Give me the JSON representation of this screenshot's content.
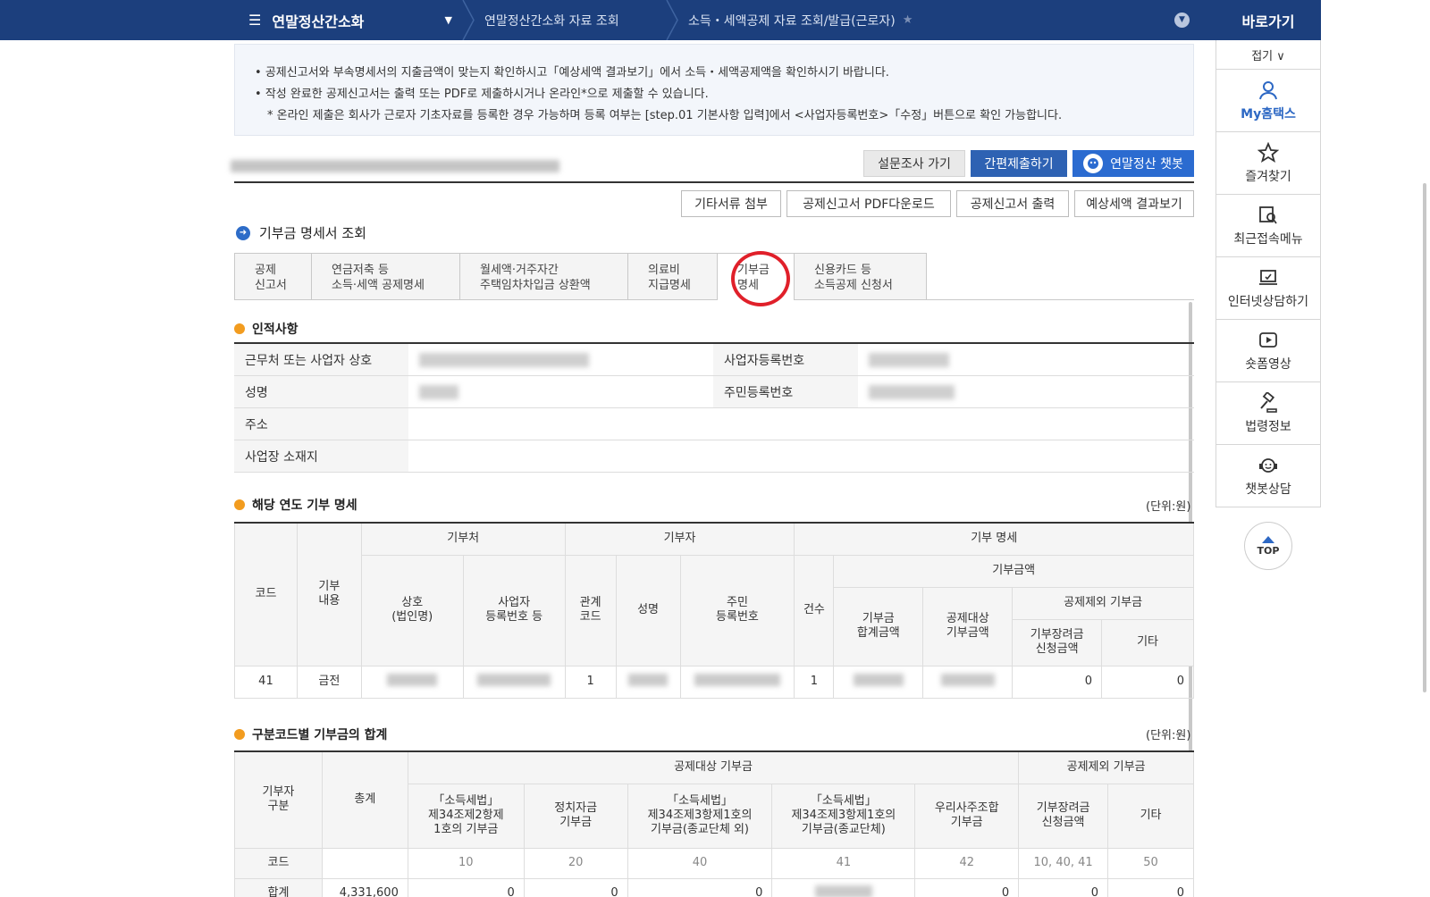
{
  "topbar": {
    "menu_label": "연말정산간소화",
    "crumb1": "연말정산간소화 자료 조회",
    "crumb2": "소득・세액공제 자료 조회/발급(근로자)"
  },
  "quick": {
    "title": "바로가기",
    "fold": "접기 ∨",
    "items": [
      "My홈택스",
      "즐겨찾기",
      "최근접속메뉴",
      "인터넷상담하기",
      "숏폼영상",
      "법령정보",
      "챗봇상담"
    ],
    "top": "TOP"
  },
  "notice": {
    "line1": "공제신고서와 부속명세서의 지출금액이 맞는지 확인하시고「예상세액 결과보기」에서 소득・세액공제액을 확인하시기 바랍니다.",
    "line2": "작성 완료한 공제신고서는 출력 또는 PDF로 제출하시거나 온라인*으로 제출할 수 있습니다.",
    "line3": "* 온라인 제출은 회사가 근로자 기초자료를 등록한 경우 가능하며 등록 여부는 [step.01 기본사항 입력]에서 <사업자등록번호>「수정」버튼으로 확인 가능합니다."
  },
  "buttons": {
    "survey": "설문조사 가기",
    "simple_submit": "간편제출하기",
    "chatbot": "연말정산 챗봇",
    "attach": "기타서류 첨부",
    "pdf": "공제신고서 PDF다운로드",
    "print": "공제신고서 출력",
    "estimate": "예상세액 결과보기"
  },
  "section_title": "기부금 명세서 조회",
  "tabs": [
    {
      "l1": "공제",
      "l2": "신고서"
    },
    {
      "l1": "연금저축 등",
      "l2": "소득·세액 공제명세"
    },
    {
      "l1": "월세액·거주자간",
      "l2": "주택임차차입금 상환액"
    },
    {
      "l1": "의료비",
      "l2": "지급명세"
    },
    {
      "l1": "기부금",
      "l2": "명세"
    },
    {
      "l1": "신용카드 등",
      "l2": "소득공제 신청서"
    }
  ],
  "personal": {
    "title": "인적사항",
    "workplace": "근무처 또는 사업자 상호",
    "bizno": "사업자등록번호",
    "name": "성명",
    "rrn": "주민등록번호",
    "address": "주소",
    "bizaddr": "사업장 소재지"
  },
  "donation": {
    "title": "해당 연도 기부 명세",
    "unit": "(단위:원)",
    "h_code": "코드",
    "h_content": "기부\n내용",
    "h_donee": "기부처",
    "h_donor": "기부자",
    "h_detail": "기부 명세",
    "h_corp": "상호\n(법인명)",
    "h_bizno": "사업자\n등록번호 등",
    "h_rel": "관계\n코드",
    "h_name": "성명",
    "h_rrn": "주민\n등록번호",
    "h_count": "건수",
    "h_amount": "기부금액",
    "h_total": "기부금\n합계금액",
    "h_target": "공제대상\n기부금액",
    "h_excl": "공제제외 기부금",
    "h_scholar": "기부장려금\n신청금액",
    "h_etc": "기타",
    "row": {
      "code": "41",
      "content": "금전",
      "rel": "1",
      "count": "1",
      "scholar": "0",
      "etc": "0"
    }
  },
  "summary": {
    "title": "구분코드별 기부금의 합계",
    "unit": "(단위:원)",
    "h_type": "기부자\n구분",
    "h_sum": "총계",
    "h_target": "공제대상 기부금",
    "h_excl": "공제제외 기부금",
    "h_c1": "「소득세법」\n제34조제2항제\n1호의 기부금",
    "h_c2": "정치자금\n기부금",
    "h_c3": "「소득세법」\n제34조제3항제1호의\n기부금(종교단체 외)",
    "h_c4": "「소득세법」\n제34조제3항제1호의\n기부금(종교단체)",
    "h_c5": "우리사주조합\n기부금",
    "h_c6": "기부장려금\n신청금액",
    "h_c7": "기타",
    "code_row": {
      "label": "코드",
      "c1": "10",
      "c2": "20",
      "c3": "40",
      "c4": "41",
      "c5": "42",
      "c6": "10, 40, 41",
      "c7": "50"
    },
    "sum_row": {
      "label": "합계",
      "total": "4,331,600",
      "c1": "0",
      "c2": "0",
      "c3": "0",
      "c5": "0",
      "c6": "0",
      "c7": "0"
    }
  }
}
